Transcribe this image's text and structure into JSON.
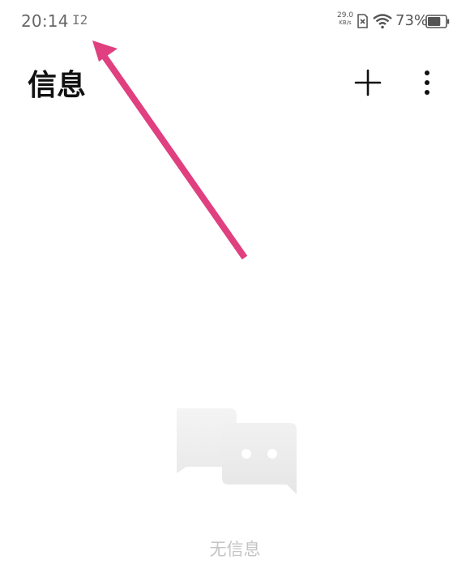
{
  "status_bar": {
    "time": "20:14",
    "notification_glyph": "I2",
    "net_speed_value": "29.0",
    "net_speed_unit": "KB/s",
    "sim_icon": "sim-x-icon",
    "wifi_icon": "wifi-icon",
    "battery_percent": "73%",
    "battery_level": 0.73
  },
  "header": {
    "title": "信息",
    "add_icon": "plus-icon",
    "more_icon": "more-vertical-icon"
  },
  "empty_state": {
    "icon": "chat-bubbles-icon",
    "label": "无信息"
  },
  "annotation": {
    "color": "#e0407f"
  }
}
